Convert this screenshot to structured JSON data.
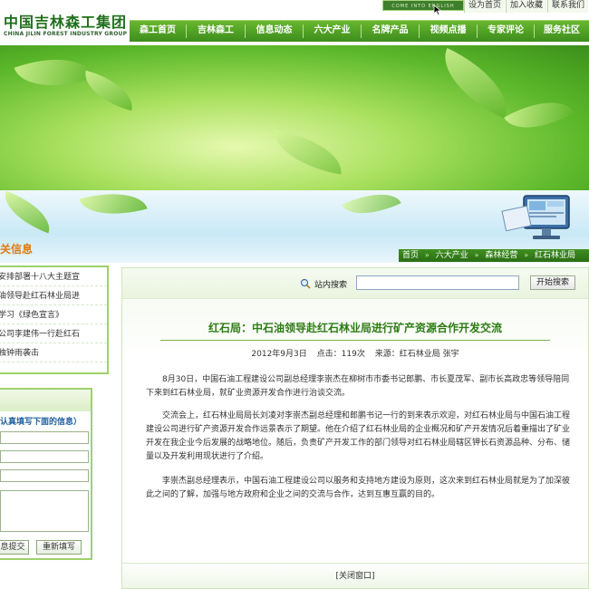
{
  "header": {
    "logo_cn": "中国吉林森工集团",
    "logo_en": "CHINA JILIN FOREST INDUSTRY GROUP",
    "english_button": "COME INTO ENGLISH",
    "top_links": [
      "设为首页",
      "加入收藏",
      "联系我们"
    ]
  },
  "nav": {
    "items": [
      "森工首页",
      "吉林森工",
      "信息动态",
      "六大产业",
      "名牌产品",
      "视频点播",
      "专家评论",
      "服务社区"
    ]
  },
  "section_title": "关信息",
  "breadcrumb": [
    "首页",
    "六大产业",
    "森林经营",
    "红石林业局"
  ],
  "left": {
    "news": [
      "安排部署十八大主题宣",
      "油领导赴红石林业局进",
      "学习《绿色宣言》",
      "公司李建伟一行赴红石",
      "独钟雨袭击"
    ],
    "message_hint": "认真填写下面的信息）",
    "submit_label": "息提交",
    "reset_label": "重新填写"
  },
  "search": {
    "label": "站内搜索",
    "button": "开始搜索"
  },
  "article": {
    "title": "红石局：中石油领导赴红石林业局进行矿产资源合作开发交流",
    "date": "2012年9月3日",
    "hits": "点击：119次",
    "source": "来源：红石林业局 张宇",
    "paragraphs": [
      "8月30日，中国石油工程建设公司副总经理李崇杰在柳树市市委书记郎鹏、市长夏茂军、副市长高政忠等领导陪同下来到红石林业局，就矿业资源开发合作进行治谈交流。",
      "交流会上，红石林业局局长刘凌对李崇杰副总经理和郎鹏书记一行的到来表示欢迎，对红石林业局与中国石油工程建设公司进行矿产资源开发合作远景表示了期望。他在介绍了红石林业局的企业概况和矿产开发情况后着重描出了矿业开发在我企业今后发展的战略地位。随后，负责矿产开发工作的部门领导对红石林业局辖区钾长石资源品种、分布、储量以及开发利用现状进行了介绍。",
      "李崇杰副总经理表示，中国石油工程建设公司以服务和支持地方建设为原则，这次来到红石林业局就是为了加深彼此之间的了解，加强与地方政府和企业之间的交流与合作，达到互惠互赢的目的。"
    ],
    "close_window": "[关闭窗口]"
  },
  "colors": {
    "nav_green": "#3c8d1c",
    "title_green": "#2d7c14",
    "section_orange": "#e07a10",
    "border_green": "#9fd16c"
  },
  "icons": {
    "search": "magnifier-icon",
    "cursor": "pointer-cursor-icon",
    "monitor": "computer-monitor-icon",
    "breadcrumb_separator": "double-arrow-icon"
  }
}
